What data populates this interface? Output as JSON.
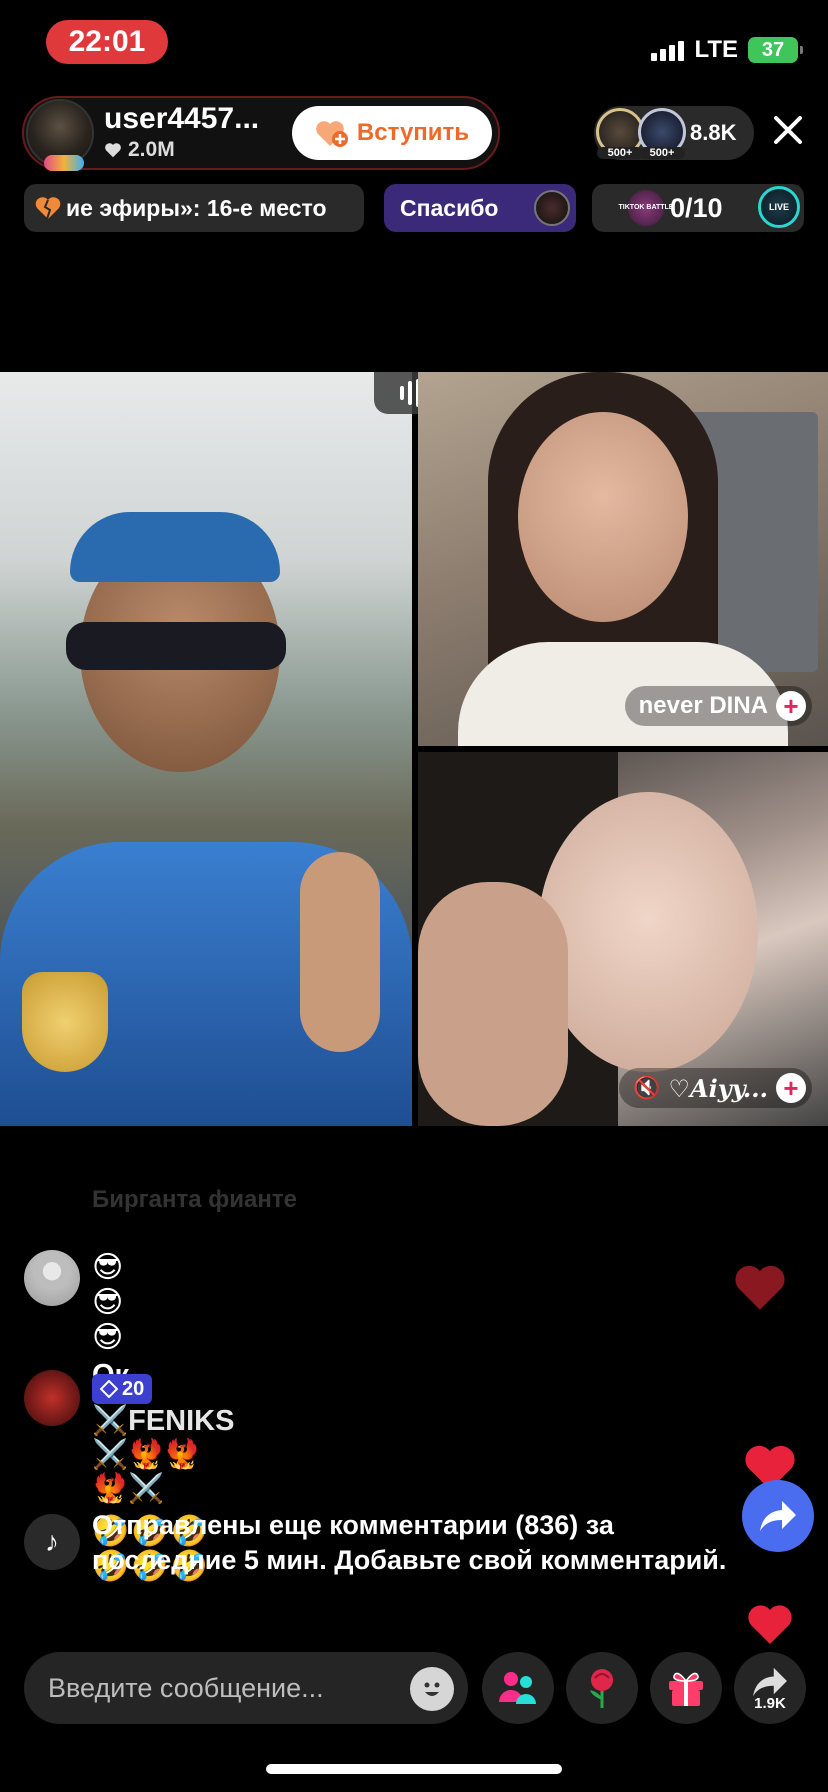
{
  "status_bar": {
    "time": "22:01",
    "network": "LTE",
    "battery": "37"
  },
  "host": {
    "name": "user4457...",
    "likes": "2.0M",
    "join_label": "Вступить"
  },
  "viewers": {
    "count": "8.8K",
    "badge_1": "500+",
    "badge_2": "500+"
  },
  "chips": {
    "rank": "ие эфиры»: 16-е место",
    "thanks": "Спасибо",
    "battle_score": "0/10",
    "battle_logo": "TIKTOK BATTLE",
    "live_badge": "LIVE"
  },
  "guests": {
    "top_right_name": "never DINA",
    "bottom_right_name": "♡Aiyy..."
  },
  "comments": {
    "faded": "Бирганта фианте",
    "c1_emoji": "😎😎😎",
    "c1_text": "Ок",
    "c2_level": "20",
    "c2_name": "⚔️FENIKS ⚔️🐦‍🔥🐦‍🔥🐦‍🔥⚔️",
    "c2_emoji": "🤣🤣🤣🤣🤣🤣",
    "system_text": "Отправлены еще комментарии (836) за последние 5 мин. Добавьте свой комментарий."
  },
  "input": {
    "placeholder": "Введите сообщение..."
  },
  "share": {
    "count": "1.9K"
  },
  "colors": {
    "accent_red": "#e0393c",
    "join_orange": "#ee6a2a",
    "thanks_purple": "#3b2a7a",
    "share_blue": "#4a6df0"
  }
}
